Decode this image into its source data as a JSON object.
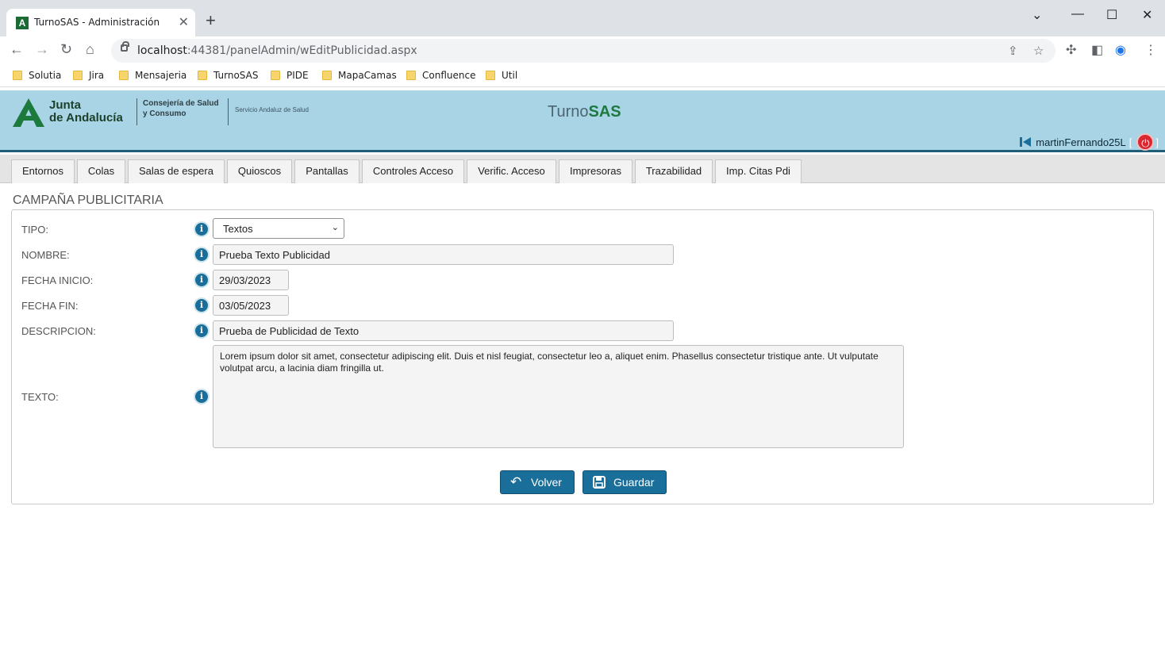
{
  "browser": {
    "tab_title": "TurnoSAS - Administración",
    "favicon_letter": "A",
    "url_host": "localhost",
    "url_path": ":44381/panelAdmin/wEditPublicidad.aspx",
    "bookmarks": [
      "Solutia",
      "Jira",
      "Mensajeria",
      "TurnoSAS",
      "PIDE",
      "MapaCamas",
      "Confluence",
      "Util"
    ]
  },
  "header": {
    "ja_line1": "Junta",
    "ja_line2": "de Andalucía",
    "consejeria_line1": "Consejería de Salud",
    "consejeria_line2": "y Consumo",
    "sas": "Servicio Andaluz de Salud",
    "brand_part1": "Turno",
    "brand_part2": "SAS",
    "username": "martinFernando25L",
    "bracket_open": "[",
    "bracket_close": "]"
  },
  "nav": {
    "tabs": [
      "Entornos",
      "Colas",
      "Salas de espera",
      "Quioscos",
      "Pantallas",
      "Controles Acceso",
      "Verific. Acceso",
      "Impresoras",
      "Trazabilidad",
      "Imp. Citas Pdi"
    ]
  },
  "form": {
    "title": "CAMPAÑA PUBLICITARIA",
    "tipo_label": "TIPO:",
    "tipo_value": "Textos",
    "nombre_label": "NOMBRE:",
    "nombre_value": "Prueba Texto Publicidad",
    "fecha_inicio_label": "FECHA INICIO:",
    "fecha_inicio_value": "29/03/2023",
    "fecha_fin_label": "FECHA FIN:",
    "fecha_fin_value": "03/05/2023",
    "descripcion_label": "DESCRIPCION:",
    "descripcion_value": "Prueba de Publicidad de Texto",
    "texto_label": "TEXTO:",
    "texto_value": "Lorem ipsum dolor sit amet, consectetur adipiscing elit. Duis et nisl feugiat, consectetur leo a, aliquet enim. Phasellus consectetur tristique ante. Ut vulputate volutpat arcu, a lacinia diam fringilla ut.",
    "info_glyph": "i",
    "volver_label": "Volver",
    "guardar_label": "Guardar"
  },
  "colors": {
    "header_bg": "#a9d4e6",
    "primary_button": "#1a6f9a",
    "brand_green": "#1c7a3d",
    "power_red": "#d9282f"
  },
  "icons": {
    "volver": "undo-arrow-icon",
    "guardar": "floppy-disk-icon",
    "info": "info-circle-icon",
    "logout": "power-icon"
  }
}
